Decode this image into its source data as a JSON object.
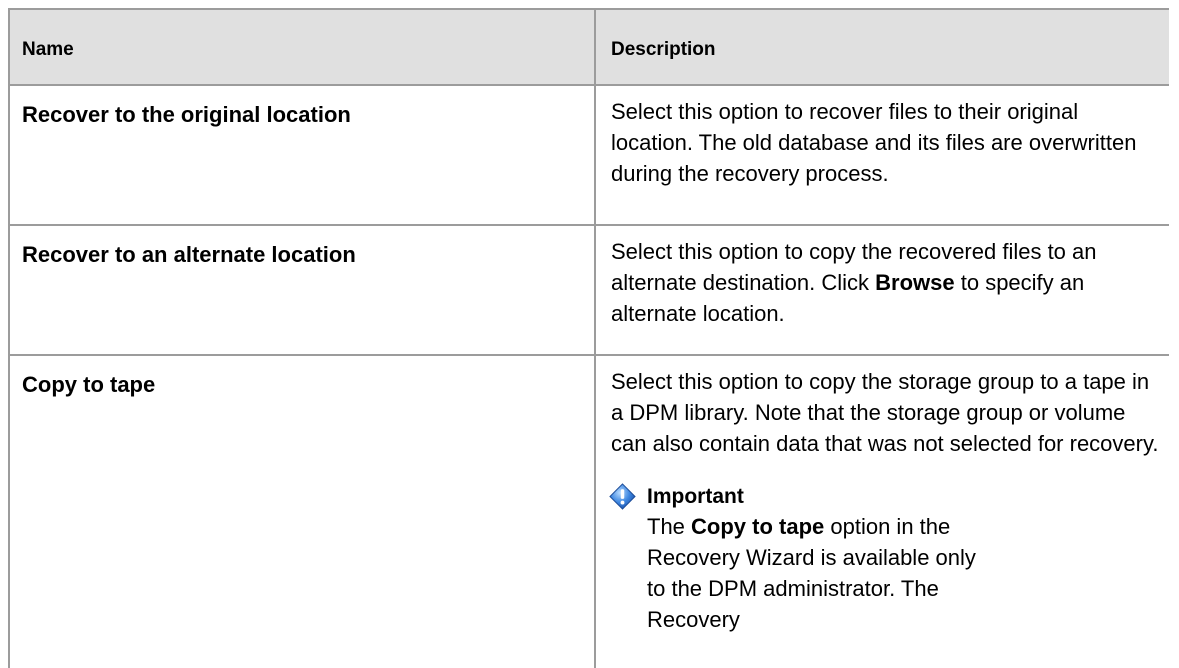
{
  "headers": {
    "name": "Name",
    "description": "Description"
  },
  "rows": [
    {
      "name": "Recover to the original location",
      "description": "Select this option to recover files to their original location. The old database and its files are overwritten during the recovery process."
    },
    {
      "name": "Recover to an alternate location",
      "description_before": "Select this option to copy the recovered files to an alternate destination. Click ",
      "description_bold": "Browse",
      "description_after": " to specify an alternate location."
    },
    {
      "name": "Copy to tape",
      "description": "Select this option to copy the storage group to a tape in a DPM library. Note that the storage group or volume can also contain data that was not selected for recovery.",
      "important": {
        "title": "Important",
        "text_before": "The ",
        "text_bold": "Copy to tape",
        "text_after": " option in the Recovery Wizard is available only to the DPM administrator. The Recovery"
      }
    }
  ],
  "icons": {
    "important": "important-icon"
  },
  "colors": {
    "header_bg": "#e0e0e0",
    "border": "#9c9c9c"
  }
}
